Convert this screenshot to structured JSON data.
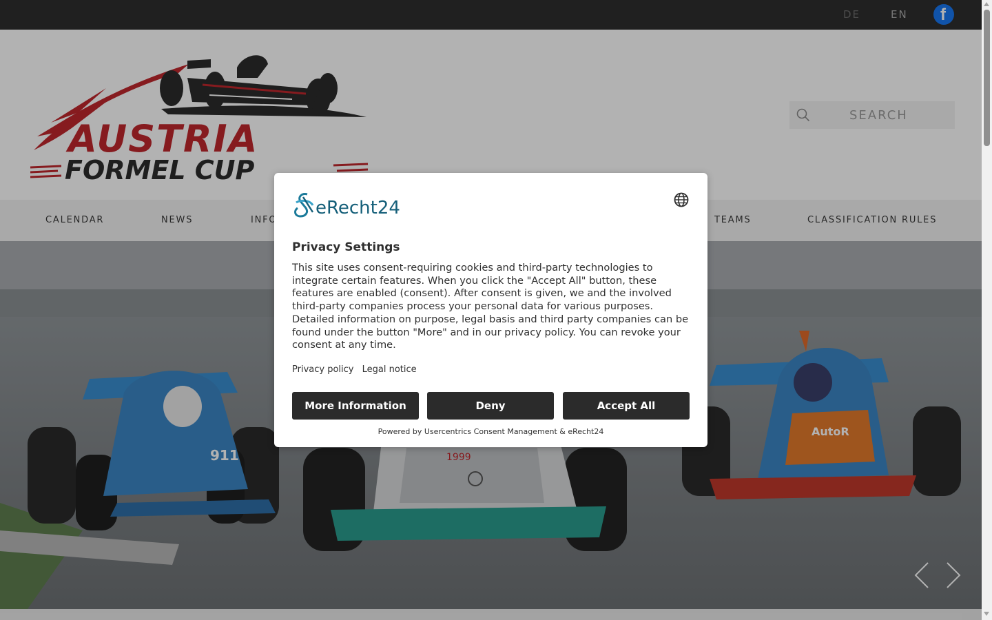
{
  "topbar": {
    "languages": [
      "DE",
      "EN"
    ],
    "facebook_icon": "facebook-icon"
  },
  "header": {
    "logo_line1": "AUSTRIA",
    "logo_line2": "FORMEL CUP",
    "search_placeholder": "SEARCH"
  },
  "nav": {
    "items": [
      "CALENDAR",
      "NEWS",
      "INFO",
      "TEAMS",
      "CLASSIFICATION RULES"
    ]
  },
  "hero": {
    "car_numbers": [
      "911"
    ],
    "sponsor_text": "AutoR"
  },
  "consent": {
    "brand": "eRecht24",
    "title": "Privacy Settings",
    "body": "This site uses consent-requiring cookies and third-party technologies to integrate certain features. When you click the \"Accept All\" button, these features are enabled (consent). After consent is given, we and the involved third-party companies process your personal data for various purposes. Detailed information on purpose, legal basis and third party companies can be found under the button \"More\" and in our privacy policy. You can revoke your consent at any time.",
    "links": [
      "Privacy policy",
      "Legal notice"
    ],
    "buttons": {
      "more": "More Information",
      "deny": "Deny",
      "accept": "Accept All"
    },
    "powered_by": "Powered by Usercentrics Consent Management & eRecht24"
  },
  "colors": {
    "topbar": "#2f2f2f",
    "logo_red": "#c1272d",
    "logo_dark": "#2b2b2b",
    "button_bg": "#2b2b2b",
    "brand_teal": "#16607a"
  }
}
